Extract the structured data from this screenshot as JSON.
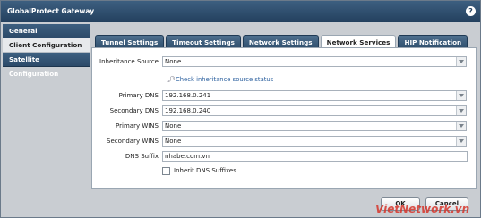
{
  "window": {
    "title": "GlobalProtect Gateway",
    "help_icon": "?"
  },
  "sidebar": {
    "items": [
      {
        "label": "General"
      },
      {
        "label": "Client Configuration"
      },
      {
        "label": "Satellite Configuration"
      }
    ],
    "active": 1
  },
  "tabs": [
    {
      "label": "Tunnel Settings"
    },
    {
      "label": "Timeout Settings"
    },
    {
      "label": "Network Settings"
    },
    {
      "label": "Network Services"
    },
    {
      "label": "HIP Notification"
    }
  ],
  "active_tab": 3,
  "form": {
    "inheritance_source": {
      "label": "Inheritance Source",
      "value": "None"
    },
    "check_link": "Check inheritance source status",
    "primary_dns": {
      "label": "Primary DNS",
      "value": "192.168.0.241"
    },
    "secondary_dns": {
      "label": "Secondary DNS",
      "value": "192.168.0.240"
    },
    "primary_wins": {
      "label": "Primary WINS",
      "value": "None"
    },
    "secondary_wins": {
      "label": "Secondary WINS",
      "value": "None"
    },
    "dns_suffix": {
      "label": "DNS Suffix",
      "value": "nhabe.com.vn"
    },
    "inherit_dns": {
      "label": "Inherit DNS Suffixes",
      "checked": false
    }
  },
  "buttons": {
    "ok": "OK",
    "cancel": "Cancel"
  },
  "watermark": "VietNetwork.vn"
}
